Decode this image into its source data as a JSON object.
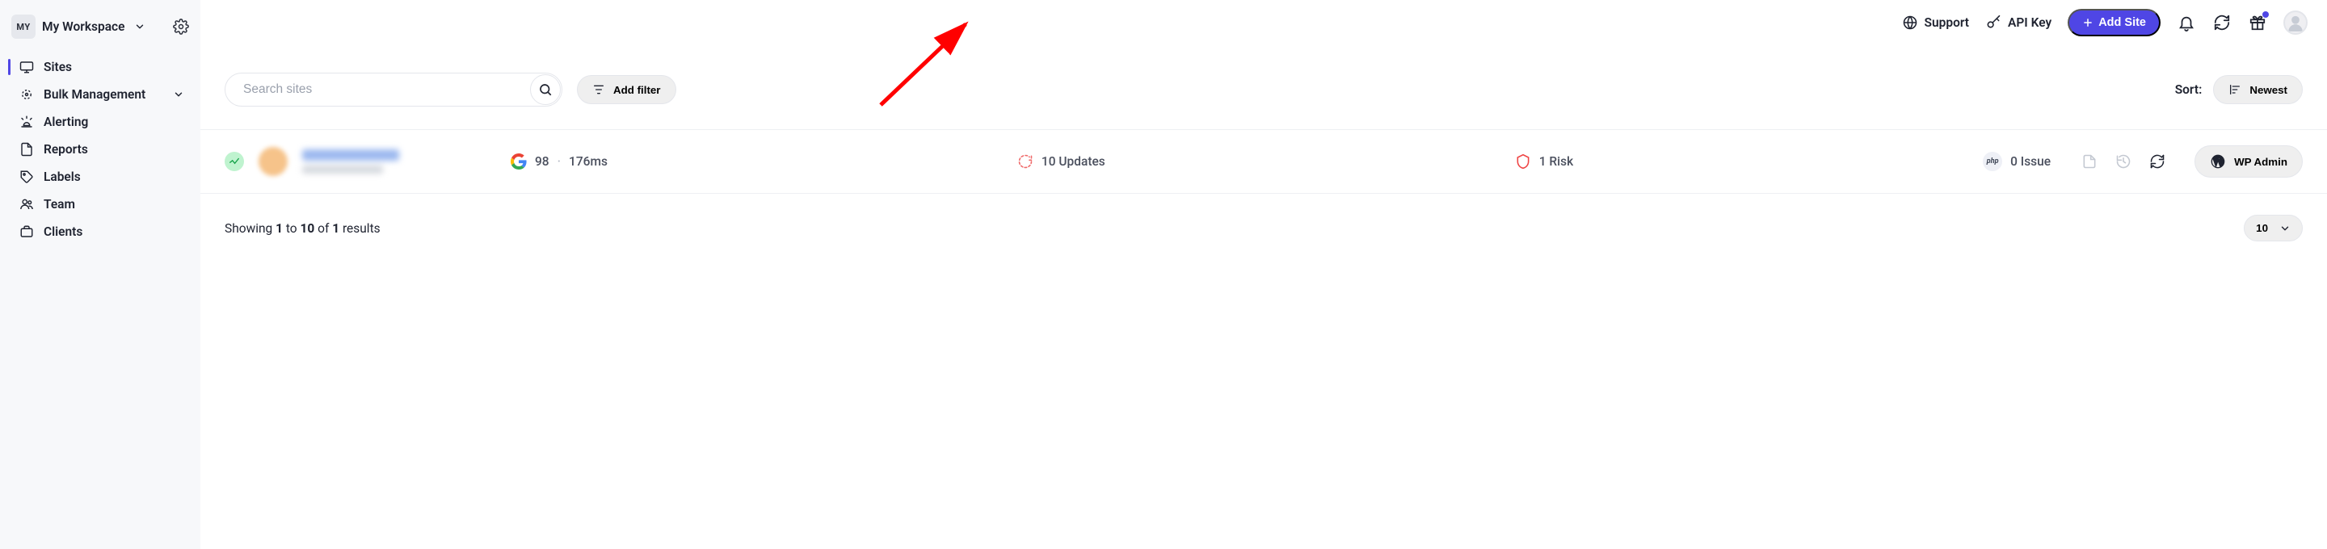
{
  "workspace": {
    "badge": "MY",
    "name": "My Workspace"
  },
  "sidebar": {
    "items": [
      {
        "label": "Sites"
      },
      {
        "label": "Bulk Management"
      },
      {
        "label": "Alerting"
      },
      {
        "label": "Reports"
      },
      {
        "label": "Labels"
      },
      {
        "label": "Team"
      },
      {
        "label": "Clients"
      }
    ]
  },
  "topbar": {
    "support": "Support",
    "api_key": "API Key",
    "add_site": "Add Site"
  },
  "toolbar": {
    "search_placeholder": "Search sites",
    "add_filter": "Add filter",
    "sort_label": "Sort:",
    "sort_value": "Newest"
  },
  "row": {
    "perf_score": "98",
    "latency": "176ms",
    "updates": "10 Updates",
    "risks": "1 Risk",
    "issues": "0 Issue",
    "php": "php",
    "wp_admin": "WP Admin"
  },
  "footer": {
    "showing": "Showing ",
    "from": "1",
    "to_word": " to ",
    "to": "10",
    "of_word": " of ",
    "total": "1",
    "results": " results",
    "page_size": "10"
  }
}
